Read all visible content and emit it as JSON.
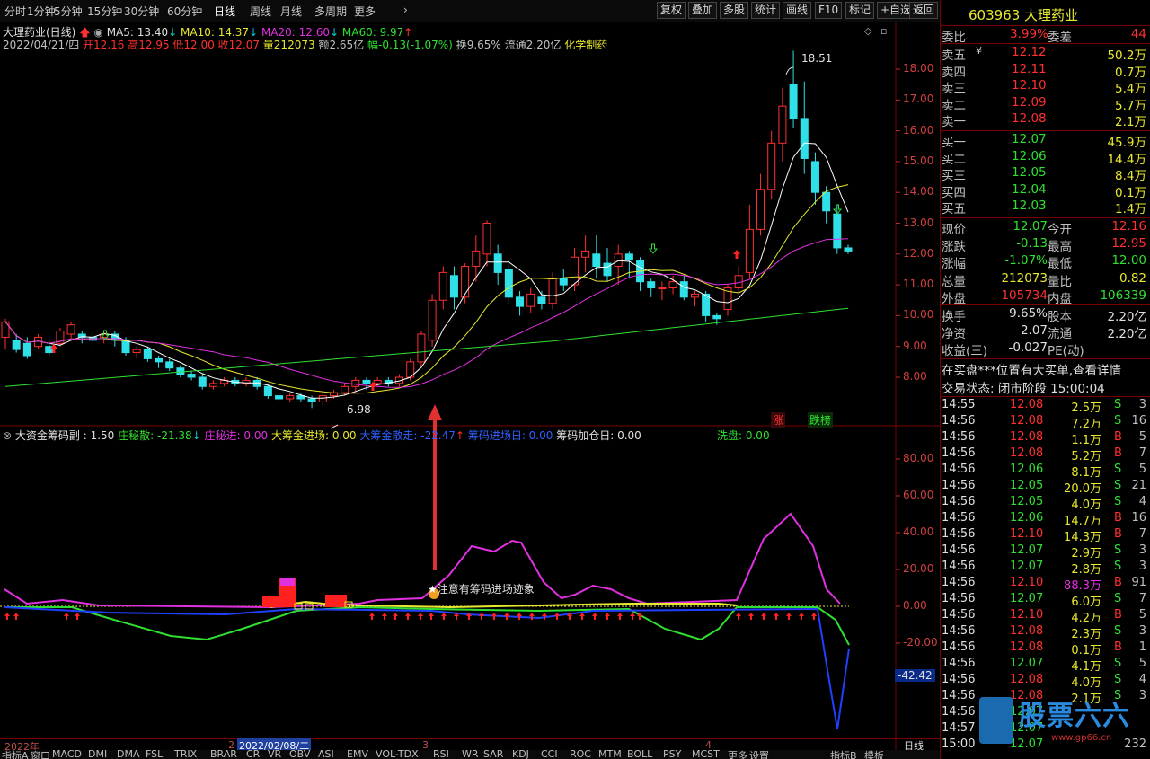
{
  "toolbar": {
    "periods": [
      "分时",
      "1分钟",
      "5分钟",
      "15分钟",
      "30分钟",
      "60分钟",
      "日线",
      "周线",
      "月线",
      "多周期",
      "更多"
    ],
    "right_buttons": [
      "复权",
      "叠加",
      "多股",
      "统计",
      "画线",
      "F10",
      "标记",
      "+自选",
      "返回"
    ]
  },
  "chart_header": {
    "name": "大理药业(日线)",
    "ma5": "MA5: 13.40",
    "ma10": "MA10: 14.37",
    "ma20": "MA20: 12.60",
    "ma60": "MA60: 9.97",
    "date": "2022/04/21/四",
    "open": "开12.16",
    "high": "高12.95",
    "low": "低12.00",
    "close": "收12.07",
    "volume": "量212073",
    "amount": "额2.65亿",
    "change": "幅-0.13(-1.07%)",
    "turnover": "换9.65%",
    "float": "流通2.20亿",
    "industry": "化学制药"
  },
  "price_axis": [
    "18.00",
    "17.00",
    "16.00",
    "15.00",
    "14.00",
    "13.00",
    "12.00",
    "11.00",
    "10.00",
    "9.00",
    "8.00"
  ],
  "price_labels": {
    "max": "18.51",
    "min": "6.98",
    "zhang": "涨",
    "diebang": "跌榜"
  },
  "indicator_header": {
    "name": "大资金筹码副 : 1.50",
    "zhuang_mi_san": "庄秘散: -21.38",
    "zhuang_mi_jin": "庄秘进: 0.00",
    "da_chou_jin": "大筹金进场: 0.00",
    "da_chou_san": "大筹金散走: -22.47",
    "chou_ma_jin": "筹码进场日: 0.00",
    "chou_ma_jia": "筹码加仓日: 0.00",
    "xi_pan": "洗盘: 0.00"
  },
  "indicator_axis": [
    "80.00",
    "60.00",
    "40.00",
    "20.00",
    "0.00",
    "-20.00"
  ],
  "indicator_current": "-42.42",
  "annotation": "注意有筹码进场迹象",
  "date_axis": {
    "y2022": "2022年",
    "m2": "2",
    "sel": "2022/02/08/二",
    "m3": "3",
    "m4": "4",
    "period": "日线"
  },
  "indicator_tabs": [
    "指标A",
    "窗口",
    "MACD",
    "DMI",
    "DMA",
    "FSL",
    "TRIX",
    "BRAR",
    "CR",
    "VR",
    "OBV",
    "ASI",
    "EMV",
    "VOL-TDX",
    "RSI",
    "WR",
    "SAR",
    "KDJ",
    "CCI",
    "ROC",
    "MTM",
    "BOLL",
    "PSY",
    "MCST",
    "更多",
    "设置"
  ],
  "indicator_tabs_right": [
    "指标B",
    "模板"
  ],
  "quote": {
    "code": "603963",
    "name": "大理药业",
    "weibi_label": "委比",
    "weibi": "3.99%",
    "weicha_label": "委差",
    "weicha": "44",
    "sells": [
      {
        "label": "卖五",
        "mark": "¥",
        "price": "12.12",
        "vol": "50.2万"
      },
      {
        "label": "卖四",
        "mark": "",
        "price": "12.11",
        "vol": "0.7万"
      },
      {
        "label": "卖三",
        "mark": "",
        "price": "12.10",
        "vol": "5.4万"
      },
      {
        "label": "卖二",
        "mark": "",
        "price": "12.09",
        "vol": "5.7万"
      },
      {
        "label": "卖一",
        "mark": "",
        "price": "12.08",
        "vol": "2.1万"
      }
    ],
    "buys": [
      {
        "label": "买一",
        "price": "12.07",
        "vol": "45.9万"
      },
      {
        "label": "买二",
        "price": "12.06",
        "vol": "14.4万"
      },
      {
        "label": "买三",
        "price": "12.05",
        "vol": "8.4万"
      },
      {
        "label": "买四",
        "price": "12.04",
        "vol": "0.1万"
      },
      {
        "label": "买五",
        "price": "12.03",
        "vol": "1.4万"
      }
    ],
    "stats": [
      {
        "l1": "现价",
        "v1": "12.07",
        "l2": "今开",
        "v2": "12.16",
        "c1": "#30e030",
        "c2": "#ff3030"
      },
      {
        "l1": "涨跌",
        "v1": "-0.13",
        "l2": "最高",
        "v2": "12.95",
        "c1": "#30e030",
        "c2": "#ff3030"
      },
      {
        "l1": "涨幅",
        "v1": "-1.07%",
        "l2": "最低",
        "v2": "12.00",
        "c1": "#30e030",
        "c2": "#30e030"
      },
      {
        "l1": "总量",
        "v1": "212073",
        "l2": "量比",
        "v2": "0.82",
        "c1": "#e8e830",
        "c2": "#e8e830"
      },
      {
        "l1": "外盘",
        "v1": "105734",
        "l2": "内盘",
        "v2": "106339",
        "c1": "#ff3030",
        "c2": "#30e030"
      }
    ],
    "stats2": [
      {
        "l1": "换手",
        "v1": "9.65%",
        "l2": "股本",
        "v2": "2.20亿"
      },
      {
        "l1": "净资",
        "v1": "2.07",
        "l2": "流通",
        "v2": "2.20亿"
      },
      {
        "l1": "收益(三)",
        "v1": "-0.027",
        "l2": "PE(动)",
        "v2": ""
      }
    ],
    "notice": "在买盘***位置有大买单,查看详情",
    "status": "交易状态: 闭市阶段 15:00:04"
  },
  "ticks": [
    {
      "t": "14:55",
      "p": "12.08",
      "v": "2.5万",
      "s": "S",
      "n": "3"
    },
    {
      "t": "14:56",
      "p": "12.08",
      "v": "7.2万",
      "s": "S",
      "n": "16"
    },
    {
      "t": "14:56",
      "p": "12.08",
      "v": "1.1万",
      "s": "B",
      "n": "5"
    },
    {
      "t": "14:56",
      "p": "12.08",
      "v": "5.2万",
      "s": "B",
      "n": "7"
    },
    {
      "t": "14:56",
      "p": "12.06",
      "v": "8.1万",
      "s": "S",
      "n": "5"
    },
    {
      "t": "14:56",
      "p": "12.05",
      "v": "20.0万",
      "s": "S",
      "n": "21"
    },
    {
      "t": "14:56",
      "p": "12.05",
      "v": "4.0万",
      "s": "S",
      "n": "4"
    },
    {
      "t": "14:56",
      "p": "12.06",
      "v": "14.7万",
      "s": "B",
      "n": "16"
    },
    {
      "t": "14:56",
      "p": "12.10",
      "v": "14.3万",
      "s": "B",
      "n": "7"
    },
    {
      "t": "14:56",
      "p": "12.07",
      "v": "2.9万",
      "s": "S",
      "n": "3"
    },
    {
      "t": "14:56",
      "p": "12.07",
      "v": "2.8万",
      "s": "S",
      "n": "3"
    },
    {
      "t": "14:56",
      "p": "12.10",
      "v": "88.3万",
      "s": "B",
      "n": "91"
    },
    {
      "t": "14:56",
      "p": "12.07",
      "v": "6.0万",
      "s": "S",
      "n": "7"
    },
    {
      "t": "14:56",
      "p": "12.10",
      "v": "4.2万",
      "s": "B",
      "n": "5"
    },
    {
      "t": "14:56",
      "p": "12.08",
      "v": "2.3万",
      "s": "S",
      "n": "3"
    },
    {
      "t": "14:56",
      "p": "12.08",
      "v": "0.1万",
      "s": "B",
      "n": "1"
    },
    {
      "t": "14:56",
      "p": "12.07",
      "v": "4.1万",
      "s": "S",
      "n": "5"
    },
    {
      "t": "14:56",
      "p": "12.08",
      "v": "4.0万",
      "s": "S",
      "n": "4"
    },
    {
      "t": "14:56",
      "p": "12.08",
      "v": "2.1万",
      "s": "S",
      "n": "3"
    },
    {
      "t": "14:56",
      "p": "12.07",
      "v": "",
      "s": "",
      "n": ""
    },
    {
      "t": "14:57",
      "p": "12.07",
      "v": "",
      "s": "",
      "n": ""
    },
    {
      "t": "15:00",
      "p": "12.07",
      "v": "",
      "s": "",
      "n": "232"
    }
  ],
  "watermark": {
    "text": "股票六六",
    "url": "www.gp66.cn"
  },
  "chart_data": {
    "type": "candlestick",
    "ylim": [
      6.5,
      19.5
    ],
    "candles": [
      [
        9.3,
        9.8,
        8.9,
        9.9
      ],
      [
        9.2,
        8.9,
        8.8,
        9.4
      ],
      [
        9.1,
        8.7,
        8.6,
        9.3
      ],
      [
        9.0,
        9.3,
        8.9,
        9.4
      ],
      [
        9.0,
        8.8,
        8.7,
        9.2
      ],
      [
        9.1,
        9.5,
        9.0,
        9.6
      ],
      [
        9.4,
        9.7,
        9.2,
        9.8
      ],
      [
        9.4,
        9.3,
        9.1,
        9.5
      ],
      [
        9.3,
        9.2,
        9.0,
        9.4
      ],
      [
        9.3,
        9.4,
        9.1,
        9.5
      ],
      [
        9.4,
        9.2,
        9.0,
        9.5
      ],
      [
        9.2,
        8.8,
        8.7,
        9.3
      ],
      [
        8.8,
        8.9,
        8.6,
        9.0
      ],
      [
        8.9,
        8.6,
        8.5,
        9.0
      ],
      [
        8.6,
        8.5,
        8.3,
        8.7
      ],
      [
        8.5,
        8.3,
        8.2,
        8.6
      ],
      [
        8.3,
        8.1,
        8.0,
        8.4
      ],
      [
        8.1,
        8.0,
        7.9,
        8.2
      ],
      [
        8.0,
        7.7,
        7.6,
        8.1
      ],
      [
        7.7,
        7.8,
        7.6,
        7.9
      ],
      [
        7.8,
        7.9,
        7.7,
        8.0
      ],
      [
        7.9,
        7.8,
        7.7,
        8.0
      ],
      [
        7.8,
        7.9,
        7.7,
        8.0
      ],
      [
        7.9,
        7.7,
        7.6,
        8.0
      ],
      [
        7.7,
        7.4,
        7.3,
        7.8
      ],
      [
        7.4,
        7.3,
        7.2,
        7.5
      ],
      [
        7.3,
        7.4,
        7.2,
        7.5
      ],
      [
        7.4,
        7.3,
        7.2,
        7.5
      ],
      [
        7.3,
        7.2,
        7.0,
        7.4
      ],
      [
        7.2,
        7.4,
        7.1,
        7.5
      ],
      [
        7.4,
        7.5,
        7.3,
        7.6
      ],
      [
        7.5,
        7.7,
        7.4,
        7.8
      ],
      [
        7.7,
        7.9,
        7.5,
        8.0
      ],
      [
        7.9,
        7.8,
        7.6,
        8.0
      ],
      [
        7.8,
        7.9,
        7.7,
        8.0
      ],
      [
        7.9,
        7.8,
        7.7,
        8.0
      ],
      [
        7.8,
        8.0,
        7.7,
        8.1
      ],
      [
        8.0,
        8.5,
        7.9,
        8.6
      ],
      [
        8.5,
        9.4,
        8.3,
        9.5
      ],
      [
        9.2,
        10.5,
        9.0,
        10.7
      ],
      [
        10.5,
        11.4,
        10.2,
        11.6
      ],
      [
        11.3,
        10.6,
        10.2,
        11.6
      ],
      [
        10.6,
        11.6,
        10.4,
        11.7
      ],
      [
        11.6,
        12.1,
        11.1,
        12.6
      ],
      [
        12.0,
        13.0,
        11.6,
        13.1
      ],
      [
        12.0,
        11.4,
        11.0,
        12.3
      ],
      [
        11.5,
        10.6,
        10.4,
        11.8
      ],
      [
        10.6,
        10.3,
        10.0,
        10.8
      ],
      [
        10.3,
        10.7,
        10.1,
        10.9
      ],
      [
        10.6,
        10.4,
        10.2,
        10.8
      ],
      [
        10.4,
        11.2,
        10.2,
        11.4
      ],
      [
        11.2,
        11.0,
        10.8,
        11.5
      ],
      [
        11.0,
        11.9,
        10.8,
        12.2
      ],
      [
        11.9,
        12.1,
        11.4,
        12.6
      ],
      [
        12.0,
        11.6,
        11.2,
        12.6
      ],
      [
        11.7,
        11.3,
        11.1,
        12.2
      ],
      [
        11.6,
        12.0,
        11.0,
        12.3
      ],
      [
        12.0,
        11.8,
        11.2,
        12.1
      ],
      [
        11.8,
        11.1,
        10.8,
        11.9
      ],
      [
        11.1,
        10.9,
        10.6,
        11.2
      ],
      [
        10.9,
        10.9,
        10.5,
        11.1
      ],
      [
        10.9,
        11.1,
        10.7,
        11.3
      ],
      [
        11.1,
        10.6,
        10.5,
        11.3
      ],
      [
        10.6,
        10.7,
        10.3,
        10.8
      ],
      [
        10.7,
        10.0,
        9.8,
        10.8
      ],
      [
        10.0,
        9.9,
        9.7,
        10.1
      ],
      [
        10.2,
        10.9,
        10.0,
        11.0
      ],
      [
        10.9,
        11.3,
        10.7,
        11.6
      ],
      [
        11.4,
        12.8,
        11.2,
        13.6
      ],
      [
        12.8,
        14.1,
        12.6,
        14.6
      ],
      [
        14.1,
        15.6,
        13.8,
        16.0
      ],
      [
        15.6,
        16.8,
        15.0,
        17.4
      ],
      [
        17.5,
        16.4,
        16.1,
        18.6
      ],
      [
        16.4,
        15.1,
        14.6,
        17.6
      ],
      [
        15.0,
        14.0,
        13.6,
        15.3
      ],
      [
        14.0,
        13.4,
        13.0,
        14.2
      ],
      [
        13.3,
        12.2,
        12.0,
        13.6
      ],
      [
        12.2,
        12.1,
        12.0,
        12.3
      ]
    ]
  }
}
